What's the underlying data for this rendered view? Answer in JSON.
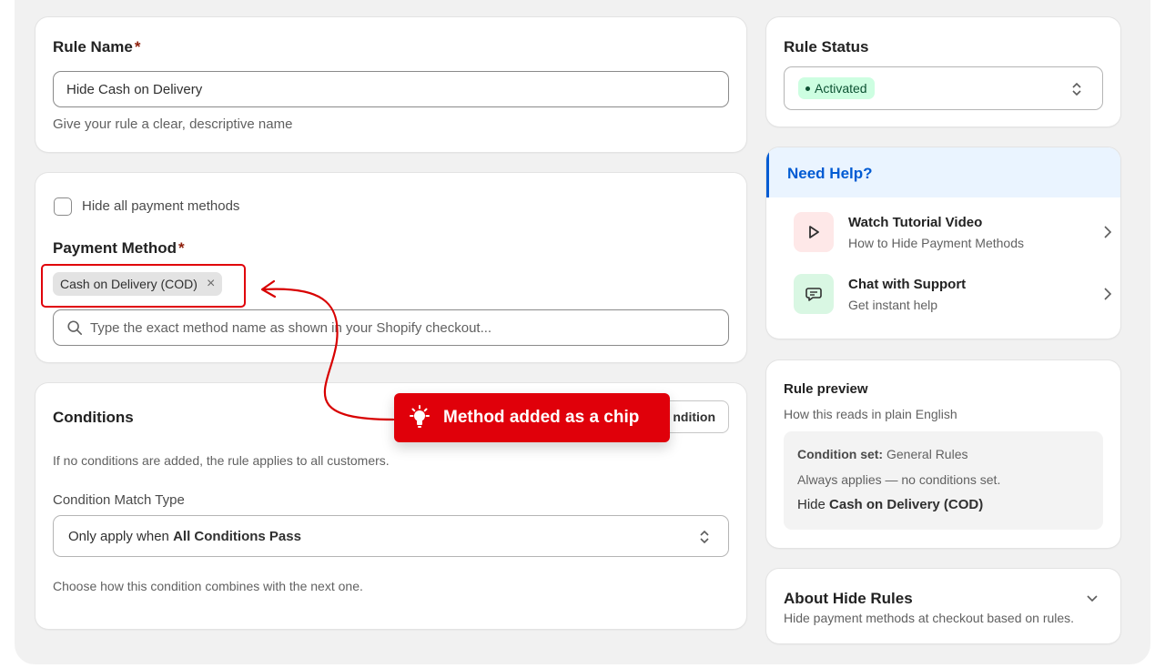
{
  "rule_name": {
    "label": "Rule Name",
    "required_mark": "*",
    "value": "Hide Cash on Delivery",
    "help": "Give your rule a clear, descriptive name"
  },
  "payment": {
    "hide_all_label": "Hide all payment methods",
    "hide_all_checked": false,
    "label": "Payment Method",
    "required_mark": "*",
    "chip": "Cash on Delivery (COD)",
    "chip_remove": "×",
    "search_placeholder": "Type the exact method name as shown in your Shopify checkout..."
  },
  "conditions": {
    "title": "Conditions",
    "add_button": "ndition",
    "empty_note": "If no conditions are added, the rule applies to all customers.",
    "match_type_label": "Condition Match Type",
    "match_prefix": "Only apply when ",
    "match_value": "All Conditions Pass",
    "combine_note": "Choose how this condition combines with the next one."
  },
  "status": {
    "title": "Rule Status",
    "value": "Activated",
    "badge_color": "#cdfee1"
  },
  "help": {
    "title": "Need Help?",
    "title_color": "#005bd3",
    "items": [
      {
        "title": "Watch Tutorial Video",
        "subtitle": "How to Hide Payment Methods",
        "icon": "play-icon",
        "bg": "#fee8e8"
      },
      {
        "title": "Chat with Support",
        "subtitle": "Get instant help",
        "icon": "chat-icon",
        "bg": "#d9f7e3"
      }
    ]
  },
  "preview": {
    "title": "Rule preview",
    "subtitle": "How this reads in plain English",
    "set_label": "Condition set:",
    "set_value": " General Rules",
    "always": "Always applies — no conditions set.",
    "hide_prefix": "Hide ",
    "hide_value": "Cash on Delivery (COD)"
  },
  "about": {
    "title": "About Hide Rules",
    "subtitle": "Hide payment methods at checkout based on rules."
  },
  "callout": {
    "text": "Method added as a chip",
    "color": "#e0000a",
    "icon": "lightbulb-icon"
  }
}
